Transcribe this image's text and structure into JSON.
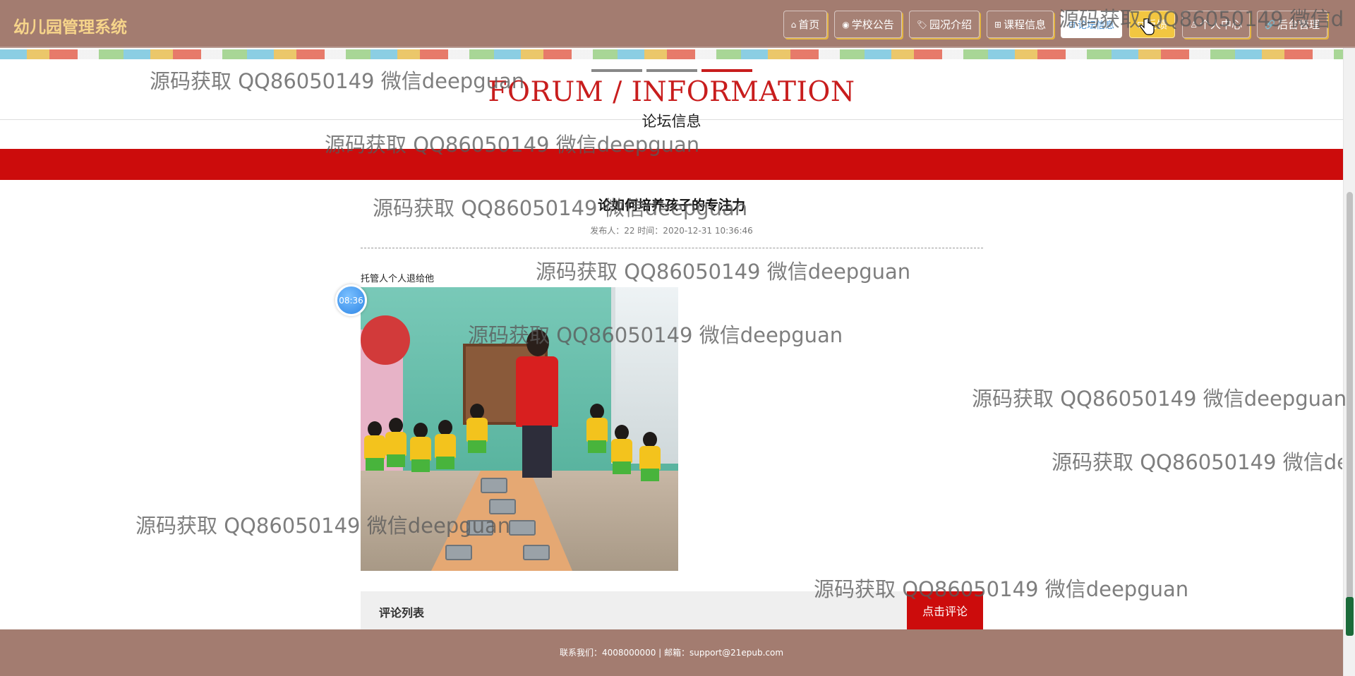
{
  "app": {
    "title": "幼儿园管理系统"
  },
  "nav": {
    "items": [
      {
        "icon": "⌂",
        "label": "首页"
      },
      {
        "icon": "◉",
        "label": "学校公告"
      },
      {
        "icon": "🏷",
        "label": "园况介绍"
      },
      {
        "icon": "⊞",
        "label": "课程信息"
      },
      {
        "icon": "⊟",
        "label": "论坛信息"
      },
      {
        "icon": "⊡",
        "label": "反馈"
      },
      {
        "icon": "♙",
        "label": "个人中心"
      },
      {
        "icon": "🔗",
        "label": "后台管理"
      }
    ],
    "active_index": 4,
    "hover_index": 5
  },
  "section": {
    "title_en": "FORUM / INFORMATION",
    "title_cn": "论坛信息"
  },
  "post": {
    "title": "论如何培养孩子的专注力",
    "meta": "发布人：22 时间：2020-12-31 10:36:46",
    "body": "托管人个人退给他",
    "image_alt": "kindergarten-classroom-photo"
  },
  "timer_badge": "08:36",
  "comments": {
    "header": "评论列表",
    "button": "点击评论"
  },
  "footer": {
    "text": "联系我们：4008000000 | 邮箱：support@21epub.com"
  },
  "watermark": "源码获取 QQ86050149 微信deepguan",
  "colors": {
    "nav_bg": "#a37c70",
    "brand": "#f6d48a",
    "accent_red": "#cc0c0c",
    "highlight": "#f2c641"
  },
  "icons": {
    "cursor": "hand-pointer-icon"
  }
}
